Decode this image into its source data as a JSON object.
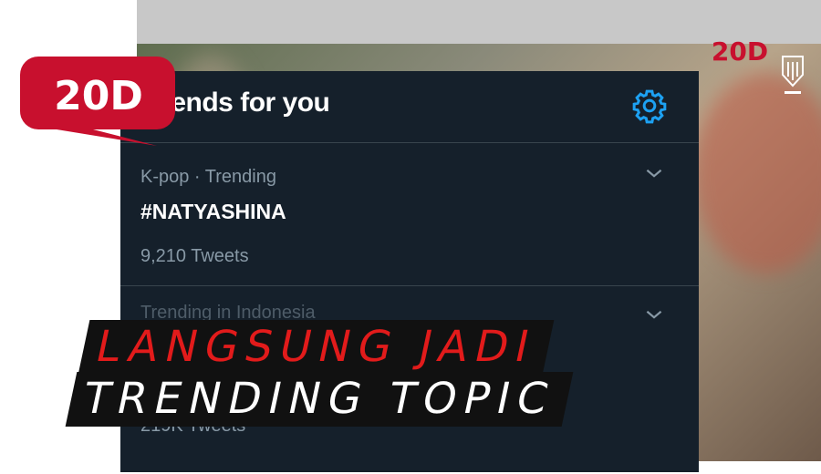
{
  "panel": {
    "title": "Trends for you",
    "settings_icon": "gear-icon"
  },
  "trends": [
    {
      "meta": "K-pop · Trending",
      "topic": "#NATYASHINA",
      "count": "9,210 Tweets"
    },
    {
      "meta": "Trending in Indonesia",
      "topic": "",
      "count": "219K Tweets"
    }
  ],
  "caption": {
    "line1": "LANGSUNG JADI",
    "line2": "TRENDING TOPIC"
  },
  "brand": {
    "logo_text": "20D",
    "accent_color": "#e21b1b",
    "logo_color": "#c8102e"
  }
}
